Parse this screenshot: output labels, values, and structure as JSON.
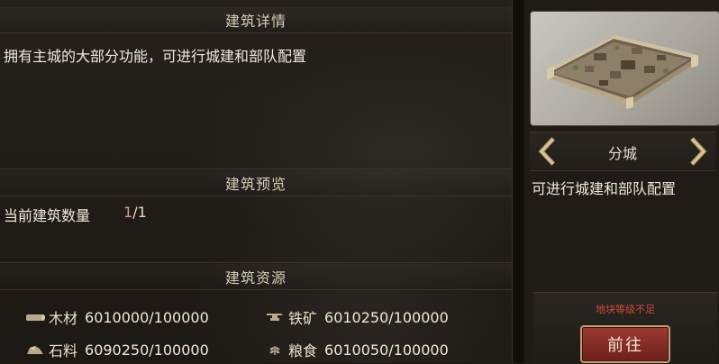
{
  "details": {
    "header": "建筑详情",
    "description": "拥有主城的大部分功能，可进行城建和部队配置"
  },
  "preview": {
    "header": "建筑预览",
    "count_label": "当前建筑数量",
    "count_current": "1",
    "count_total": "/1"
  },
  "resources": {
    "header": "建筑资源",
    "items": [
      {
        "name": "木材",
        "value": "6010000/100000",
        "icon": "wood-icon"
      },
      {
        "name": "铁矿",
        "value": "6010250/100000",
        "icon": "anvil-icon"
      },
      {
        "name": "石料",
        "value": "6090250/100000",
        "icon": "stone-icon"
      },
      {
        "name": "粮食",
        "value": "6010050/100000",
        "icon": "grain-icon"
      }
    ]
  },
  "building": {
    "name": "分城",
    "description": "可进行城建和部队配置"
  },
  "action": {
    "warning": "地块等级不足",
    "button_label": "前往"
  },
  "colors": {
    "warning": "#d04a3a",
    "button": "#8a2f28",
    "accent_gold": "#c79a6b"
  }
}
